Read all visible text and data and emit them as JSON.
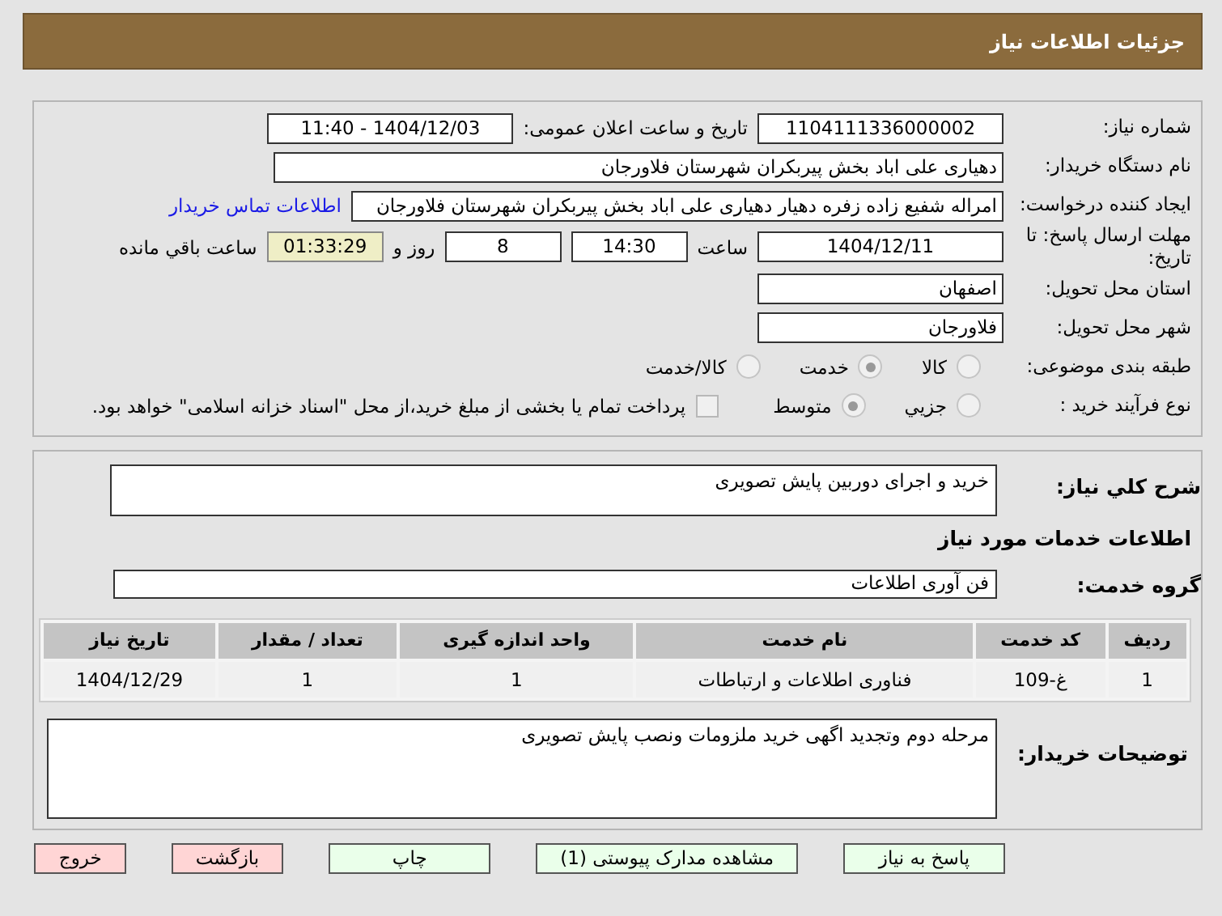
{
  "header": {
    "title": "جزئیات اطلاعات نیاز"
  },
  "info": {
    "need_number_label": "شماره نیاز:",
    "need_number": "1104111336000002",
    "announce_label": "تاریخ و ساعت اعلان عمومی:",
    "announce": "1404/12/03 - 11:40",
    "buyer_label": "نام دستگاه خریدار:",
    "buyer": "دهیاری علی اباد بخش پیربکران شهرستان فلاورجان",
    "creator_label": "ایجاد کننده درخواست:",
    "creator": "امراله شفیع زاده زفره دهیار دهیاری علی اباد بخش پیربکران شهرستان فلاورجان",
    "contact_link": "اطلاعات تماس خریدار",
    "deadline_label": "مهلت ارسال پاسخ: تا تاریخ:",
    "deadline_date": "1404/12/11",
    "time_label": "ساعت",
    "deadline_time": "14:30",
    "days": "8",
    "days_label": "روز و",
    "remaining": "01:33:29",
    "remaining_label": "ساعت باقي مانده",
    "province_label": "استان محل تحویل:",
    "province": "اصفهان",
    "city_label": "شهر محل تحویل:",
    "city": "فلاورجان"
  },
  "category": {
    "label": "طبقه بندی موضوعی:",
    "options": [
      {
        "label": "کالا",
        "selected": false
      },
      {
        "label": "خدمت",
        "selected": true
      },
      {
        "label": "کالا/خدمت",
        "selected": false
      }
    ]
  },
  "process": {
    "label": "نوع فرآیند خرید :",
    "options": [
      {
        "label": "جزيي",
        "selected": false
      },
      {
        "label": "متوسط",
        "selected": true
      }
    ],
    "payment": {
      "checked": false,
      "text": "پرداخت تمام یا بخشی از مبلغ خرید،از محل \"اسناد خزانه اسلامی\" خواهد بود."
    }
  },
  "summary": {
    "label": "شرح کلي نیاز:",
    "value": "خرید و اجرای دوربین پایش تصویری"
  },
  "services_title": "اطلاعات خدمات مورد نیاز",
  "service_group": {
    "label": "گروه خدمت:",
    "value": "فن آوری اطلاعات"
  },
  "table": {
    "columns": [
      "ردیف",
      "کد خدمت",
      "نام خدمت",
      "واحد اندازه گیری",
      "تعداد / مقدار",
      "تاریخ نیاز"
    ],
    "rows": [
      [
        "1",
        "غ-109",
        "فناوری اطلاعات و ارتباطات",
        "1",
        "1",
        "1404/12/29"
      ]
    ]
  },
  "notes": {
    "label": "توضیحات خریدار:",
    "value": "مرحله دوم وتجدید  اگهی خرید  ملزومات ونصب پایش تصویری"
  },
  "buttons": [
    {
      "label": "پاسخ به نیاز",
      "kind": "green"
    },
    {
      "label": "مشاهده مدارک پیوستی (1)",
      "kind": "green"
    },
    {
      "label": "چاپ",
      "kind": "green"
    },
    {
      "label": "بازگشت",
      "kind": "red"
    },
    {
      "label": "خروج",
      "kind": "red"
    }
  ]
}
